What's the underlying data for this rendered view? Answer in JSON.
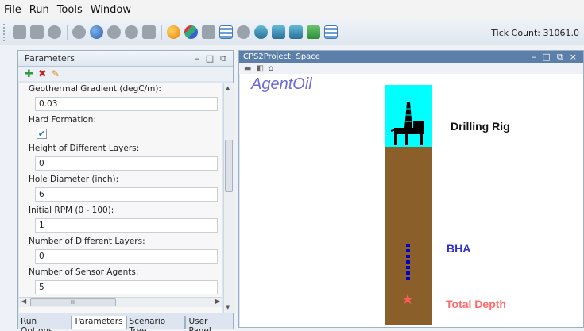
{
  "menu": [
    "File",
    "Run",
    "Tools",
    "Window"
  ],
  "toolbar": {
    "tick_count": "Tick Count: 31061.0"
  },
  "parameters_panel": {
    "title": "Parameters",
    "window_controls": {
      "minimize": "–",
      "maximize": "□",
      "restore": "⧉"
    },
    "fields": [
      {
        "label": "Geothermal Gradient (degC/m):",
        "value": "0.03"
      },
      {
        "label": "Hard Formation:",
        "checked": true
      },
      {
        "label": "Height of Different Layers:",
        "value": "0"
      },
      {
        "label": "Hole Diameter (inch):",
        "value": "6"
      },
      {
        "label": "Initial RPM (0 - 100):",
        "value": "1"
      },
      {
        "label": "Number of Different Layers:",
        "value": "0"
      },
      {
        "label": "Number of Sensor Agents:",
        "value": "5"
      }
    ],
    "hscroll_thumb_label": "III",
    "tabs": [
      {
        "label": "Run Options",
        "active": false
      },
      {
        "label": "Parameters",
        "active": true
      },
      {
        "label": "Scenario Tree",
        "active": false
      },
      {
        "label": "User Panel",
        "active": false
      }
    ]
  },
  "space_panel": {
    "title": "CPS2Project: Space",
    "window_controls": {
      "minimize": "–",
      "maximize": "□",
      "restore": "⧉",
      "close": "×"
    },
    "canvas": {
      "agent_title": "AgentOil",
      "rig_label": "Drilling Rig",
      "bha_label": "BHA",
      "depth_label": "Total Depth"
    }
  },
  "colors": {
    "sky": "#00ffff",
    "ground": "#8a5f2a",
    "bha": "#0000cc",
    "depth_marker": "#ff5a5a"
  }
}
